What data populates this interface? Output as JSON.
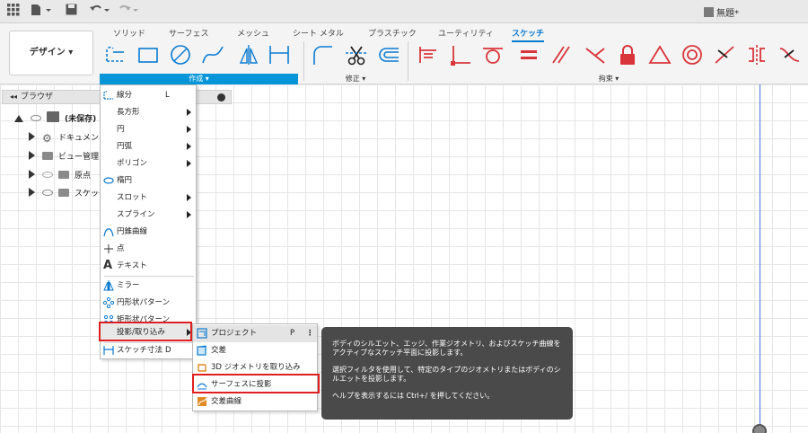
{
  "topbar": {
    "doc_title": "無題*"
  },
  "ribbon": {
    "design_button": "デザイン ▾",
    "tabs": [
      "ソリッド",
      "サーフェス",
      "メッシュ",
      "シート メタル",
      "プラスチック",
      "ユーティリティ",
      "スケッチ"
    ],
    "groups": {
      "create": "作成 ▾",
      "modify": "修正 ▾",
      "constraints": "拘束 ▾"
    }
  },
  "browser": {
    "title": "ブラウザ",
    "items": [
      {
        "label": "(未保存)"
      },
      {
        "label": "ドキュメント"
      },
      {
        "label": "ビュー管理"
      },
      {
        "label": "原点"
      },
      {
        "label": "スケッチ"
      }
    ]
  },
  "create_menu": {
    "items": [
      {
        "label": "線分",
        "key": "L"
      },
      {
        "label": "長方形"
      },
      {
        "label": "円"
      },
      {
        "label": "円弧"
      },
      {
        "label": "ポリゴン"
      },
      {
        "label": "楕円"
      },
      {
        "label": "スロット"
      },
      {
        "label": "スプライン"
      },
      {
        "label": "円錐曲線"
      },
      {
        "label": "点"
      },
      {
        "label": "テキスト"
      },
      {
        "label": "ミラー"
      },
      {
        "label": "円形状パターン"
      },
      {
        "label": "矩形状パターン"
      },
      {
        "label": "投影/取り込み"
      },
      {
        "label": "スケッチ寸法",
        "key": "D"
      }
    ]
  },
  "project_submenu": {
    "items": [
      {
        "label": "プロジェクト",
        "key": "P",
        "more": "⋮"
      },
      {
        "label": "交差"
      },
      {
        "label": "3D ジオメトリを取り込み"
      },
      {
        "label": "サーフェスに投影"
      },
      {
        "label": "交差曲線"
      }
    ]
  },
  "tooltip": {
    "line1": "ボディのシルエット、エッジ、作業ジオメトリ、およびスケッチ曲線をアクティブなスケッチ平面に投影します。",
    "line2": "選択フィルタを使用して、特定のタイプのジオメトリまたはボディのシルエットを投影します。",
    "line3": "ヘルプを表示するには Ctrl+/ を押してください。"
  },
  "colors": {
    "accent": "#0696d7",
    "highlight_box": "#e02020",
    "constraint_red": "#d9343a",
    "tooltip_bg": "#4a4a4a"
  }
}
